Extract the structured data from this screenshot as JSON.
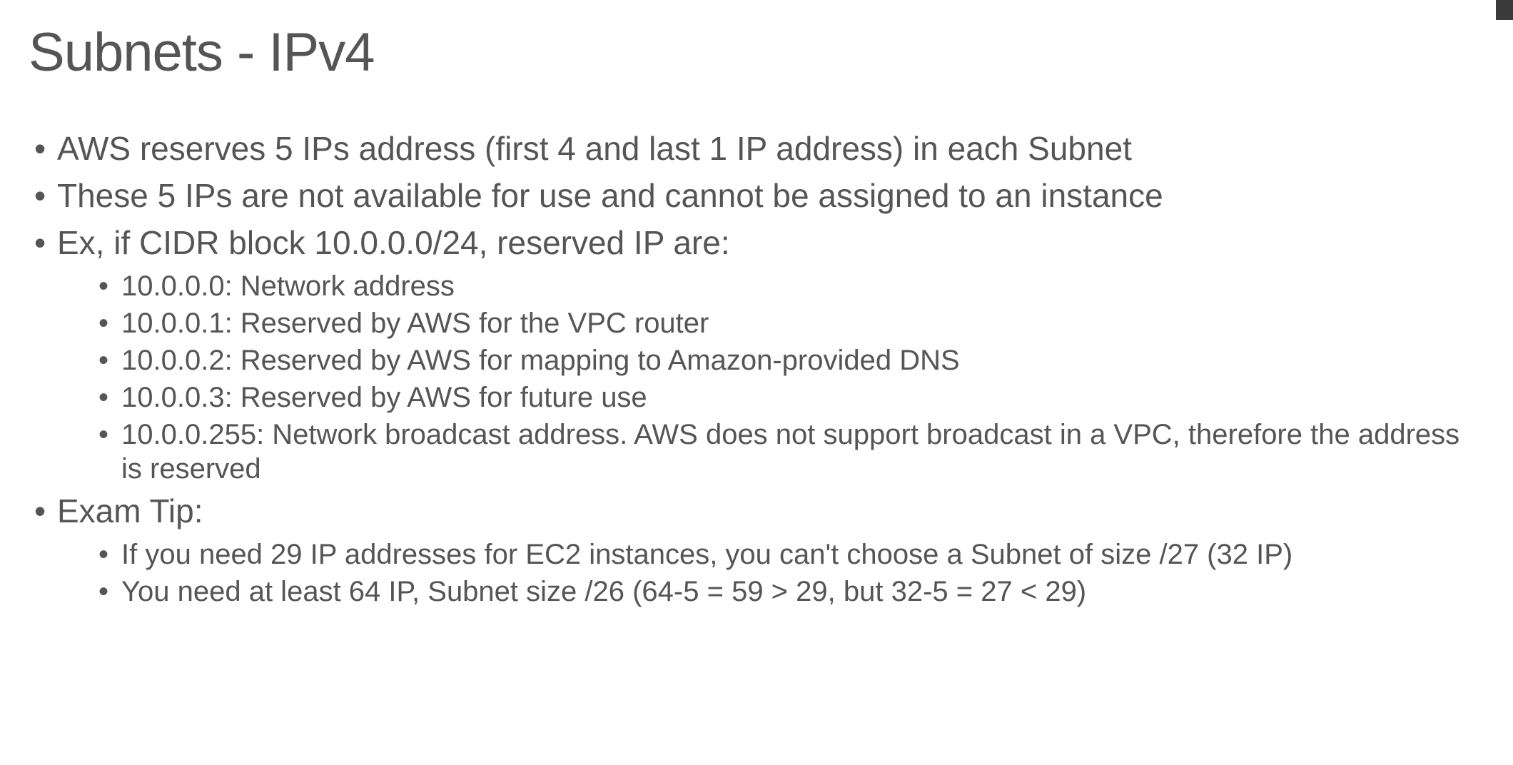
{
  "title": "Subnets - IPv4",
  "bullets": [
    {
      "text": "AWS reserves 5 IPs address (first 4 and last 1 IP address) in each Subnet"
    },
    {
      "text": "These 5 IPs are not available for use and cannot be assigned to an instance"
    },
    {
      "text": "Ex, if CIDR block 10.0.0.0/24, reserved IP are:",
      "sub": [
        "10.0.0.0: Network address",
        "10.0.0.1: Reserved by AWS for the VPC router",
        "10.0.0.2: Reserved by AWS for mapping to Amazon-provided DNS",
        "10.0.0.3: Reserved by AWS for future use",
        "10.0.0.255: Network broadcast address. AWS does not support broadcast in a VPC, therefore the address is reserved"
      ]
    },
    {
      "text": "Exam Tip:",
      "sub": [
        "If you need 29 IP addresses for EC2 instances, you can't choose a Subnet of size /27 (32 IP)",
        "You need at least 64 IP, Subnet size /26 (64-5 = 59 > 29, but 32-5 = 27 < 29)"
      ]
    }
  ]
}
